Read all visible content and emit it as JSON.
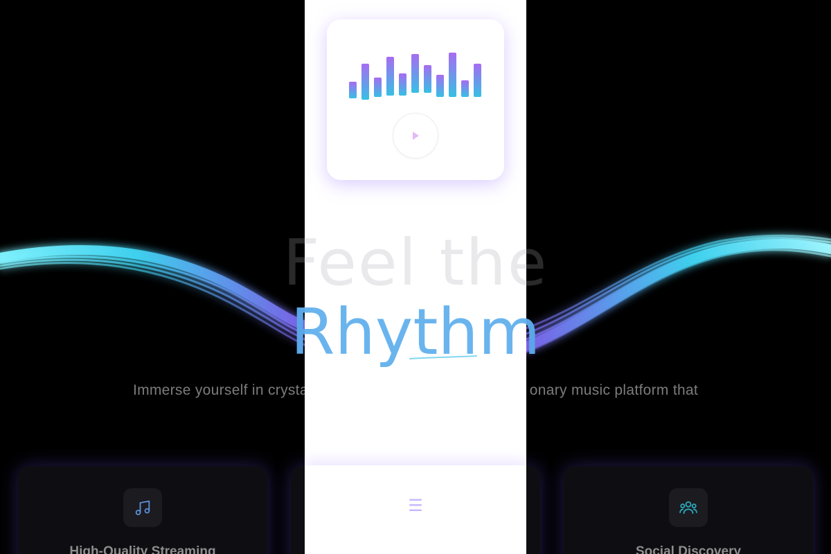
{
  "hero": {
    "title_top": "Feel the",
    "title_accent": "Rhythm",
    "subtitle_left": "Immerse yourself in crysta",
    "subtitle_right": "onary music platform that"
  },
  "features": [
    {
      "title": "High-Quality Streaming",
      "icon": "music-note-icon"
    },
    {
      "title": "",
      "icon": ""
    },
    {
      "title": "Social Discovery",
      "icon": "users-icon"
    }
  ],
  "mobile": {
    "player": {
      "play_icon": "play-icon"
    },
    "menu_icon": "☰"
  },
  "colors": {
    "accent_blue": "#5aa6e6",
    "accent_purple": "#a274f5",
    "accent_cyan": "#35c5e8",
    "background": "#000000"
  }
}
